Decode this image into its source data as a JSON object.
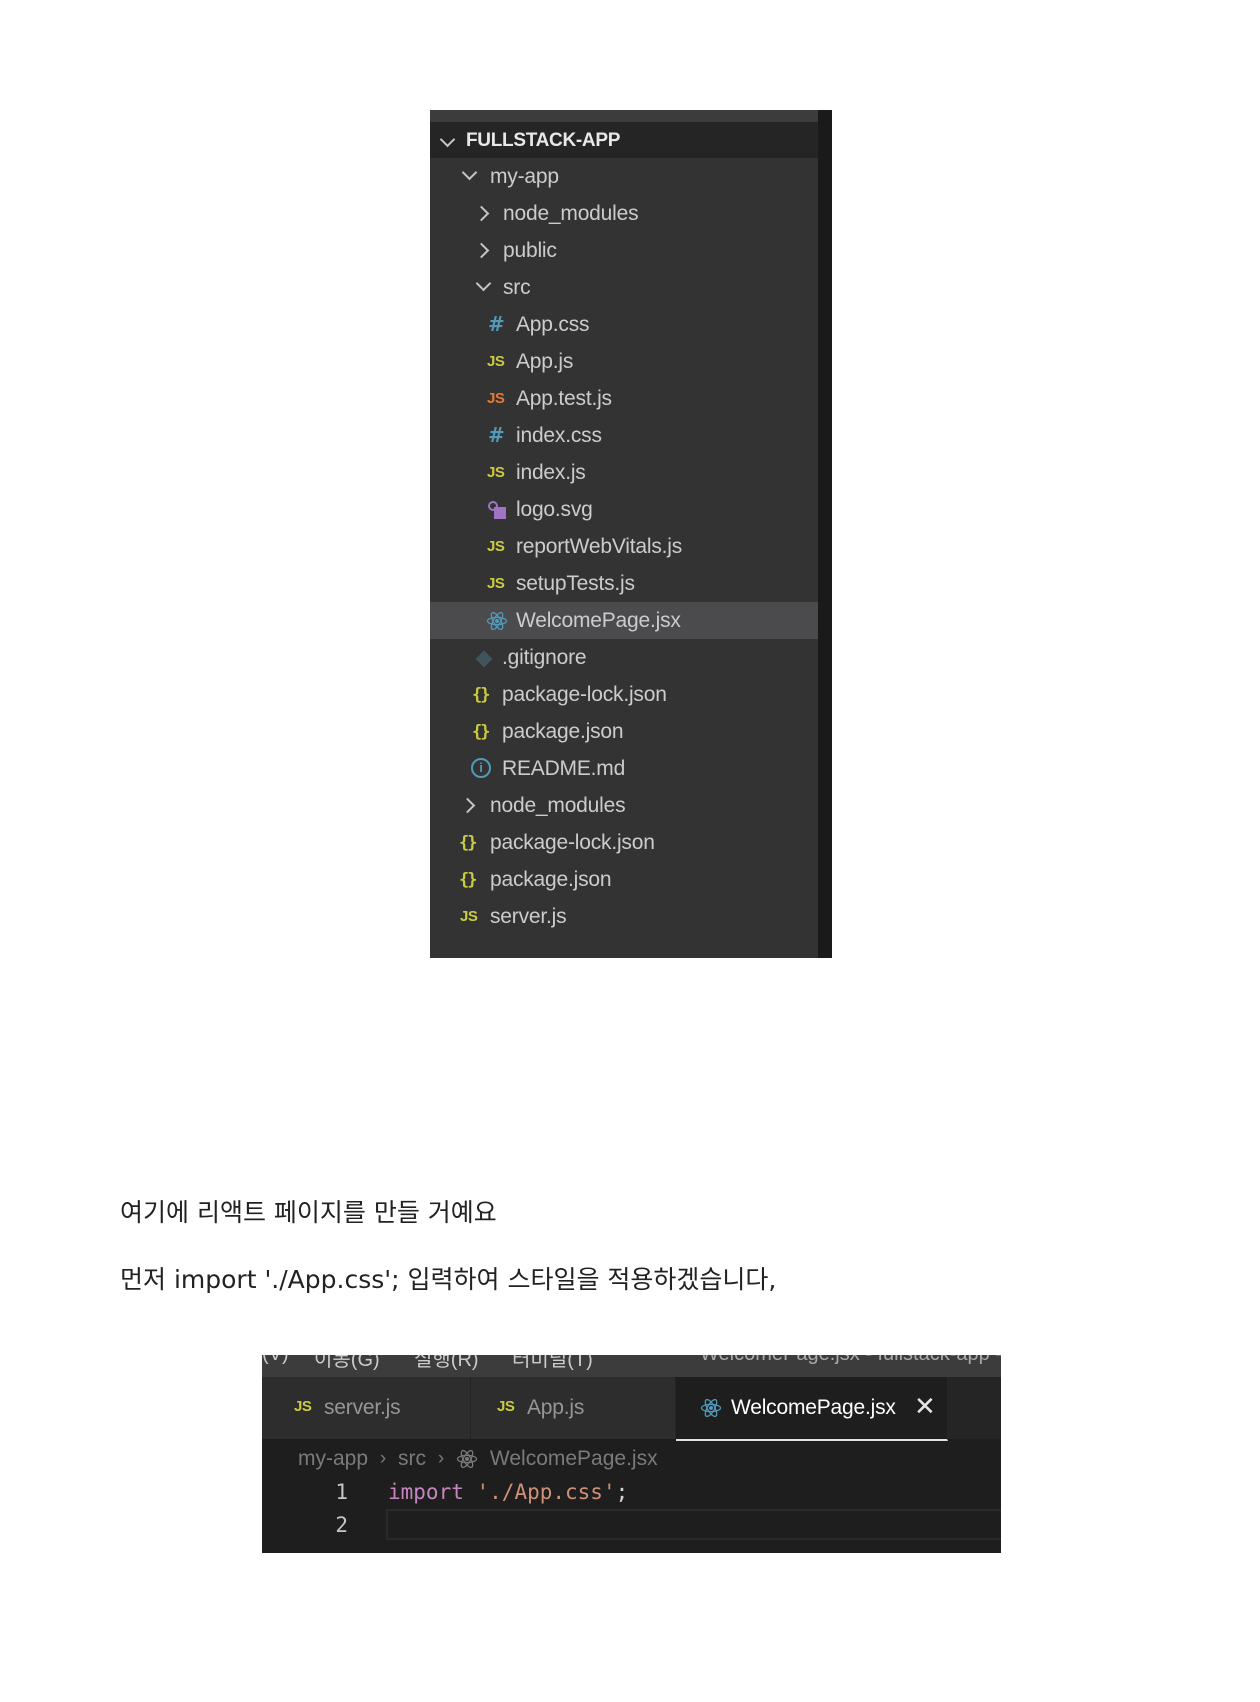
{
  "explorer": {
    "workspace_title": "FULLSTACK-APP",
    "items": [
      {
        "label": "my-app",
        "kind": "folder",
        "expanded": true,
        "depth": 1
      },
      {
        "label": "node_modules",
        "kind": "folder",
        "expanded": false,
        "depth": 2
      },
      {
        "label": "public",
        "kind": "folder",
        "expanded": false,
        "depth": 2
      },
      {
        "label": "src",
        "kind": "folder",
        "expanded": true,
        "depth": 2
      },
      {
        "label": "App.css",
        "kind": "css",
        "icon": "css-hash-icon",
        "depth": 3
      },
      {
        "label": "App.js",
        "kind": "js",
        "icon": "js-icon",
        "depth": 3
      },
      {
        "label": "App.test.js",
        "kind": "js-test",
        "icon": "js-test-icon",
        "depth": 3
      },
      {
        "label": "index.css",
        "kind": "css",
        "icon": "css-hash-icon",
        "depth": 3
      },
      {
        "label": "index.js",
        "kind": "js",
        "icon": "js-icon",
        "depth": 3
      },
      {
        "label": "logo.svg",
        "kind": "svg",
        "icon": "svg-file-icon",
        "depth": 3
      },
      {
        "label": "reportWebVitals.js",
        "kind": "js",
        "icon": "js-icon",
        "depth": 3
      },
      {
        "label": "setupTests.js",
        "kind": "js",
        "icon": "js-icon",
        "depth": 3
      },
      {
        "label": "WelcomePage.jsx",
        "kind": "jsx",
        "icon": "react-icon",
        "depth": 3,
        "selected": true
      },
      {
        "label": ".gitignore",
        "kind": "git",
        "icon": "git-icon",
        "depth": 2
      },
      {
        "label": "package-lock.json",
        "kind": "json",
        "icon": "json-braces-icon",
        "depth": 2
      },
      {
        "label": "package.json",
        "kind": "json",
        "icon": "json-braces-icon",
        "depth": 2
      },
      {
        "label": "README.md",
        "kind": "md",
        "icon": "info-icon",
        "depth": 2
      },
      {
        "label": "node_modules",
        "kind": "folder",
        "expanded": false,
        "depth": 1
      },
      {
        "label": "package-lock.json",
        "kind": "json",
        "icon": "json-braces-icon",
        "depth": 1
      },
      {
        "label": "package.json",
        "kind": "json",
        "icon": "json-braces-icon",
        "depth": 1
      },
      {
        "label": "server.js",
        "kind": "js",
        "icon": "js-icon",
        "depth": 1
      }
    ]
  },
  "text": {
    "line1": "여기에 리액트 페이지를 만들 거예요",
    "line2": "먼저 import './App.css'; 입력하여 스타일을 적용하겠습니다,"
  },
  "editor": {
    "menu": [
      "(V)",
      "이동(G)",
      "실행(R)",
      "터미널(T)"
    ],
    "window_title": "WelcomePage.jsx - fullstack-app -",
    "tabs": [
      {
        "label": "server.js",
        "icon": "js-icon",
        "active": false
      },
      {
        "label": "App.js",
        "icon": "js-icon",
        "active": false
      },
      {
        "label": "WelcomePage.jsx",
        "icon": "react-icon",
        "active": true,
        "close": "✕"
      }
    ],
    "breadcrumb": [
      "my-app",
      "src",
      "WelcomePage.jsx"
    ],
    "breadcrumb_sep": "›",
    "lines": [
      {
        "number": "1",
        "keyword": "import",
        "string": "'./App.css'",
        "punct": ";"
      },
      {
        "number": "2",
        "keyword": "",
        "string": "",
        "punct": ""
      }
    ]
  },
  "colors": {
    "js_icon": "#cbcb41",
    "js_test_icon": "#e37933",
    "css_icon": "#519aba",
    "react_icon": "#519aba",
    "svg_icon": "#a074c4",
    "keyword": "#c586c0",
    "string": "#ce9178"
  }
}
